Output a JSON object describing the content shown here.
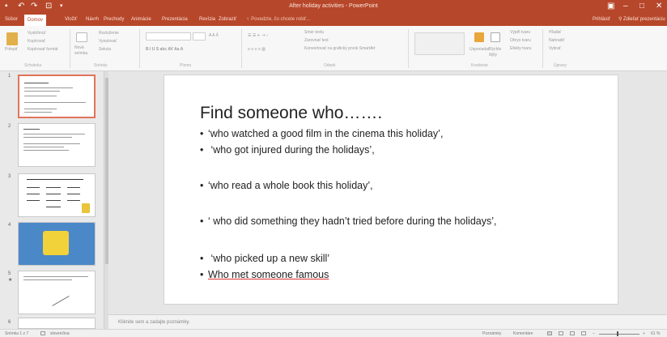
{
  "window": {
    "title": "After holiday activities - PowerPoint",
    "controls": {
      "restore": "▣",
      "minimize": "–",
      "maximize": "□",
      "close": "✕"
    },
    "qat": [
      "save-icon",
      "undo-icon",
      "redo-icon",
      "present-icon",
      "customize-icon"
    ]
  },
  "ribbon_tabs": {
    "items": [
      "Súbor",
      "Domov",
      "Vložiť",
      "Návrh",
      "Prechody",
      "Animácie",
      "Prezentácia",
      "Revízia",
      "Zobraziť"
    ],
    "active": "Domov",
    "tell_me": "♀ Povedzte, čo chcete robiť...",
    "sign_in": "Prihlásiť",
    "share": "⚲ Zdieľať prezentáciu"
  },
  "ribbon": {
    "clipboard": {
      "paste": "Prilepiť",
      "cut": "Vystrihnúť",
      "copy": "Kopírovať",
      "painter": "Kopírovať formát",
      "label": "Schránka"
    },
    "slides": {
      "new_slide": "Nová snímka",
      "layout": "Rozloženie",
      "reset": "Vynulovať",
      "section": "Sekcia",
      "label": "Snímky"
    },
    "font": {
      "label": "Písmo"
    },
    "paragraph": {
      "text_direction": "Smer textu",
      "align_text": "Zarovnať text",
      "smartart": "Konvertovať na grafický prvok SmartArt",
      "label": "Odsek"
    },
    "drawing": {
      "arrange": "Usporiadať",
      "quick_styles": "Rýchle štýly",
      "shape_fill": "Výplň tvaru",
      "shape_outline": "Obrys tvaru",
      "shape_effects": "Efekty tvaru",
      "label": "Kreslenie"
    },
    "editing": {
      "find": "Hľadať",
      "replace": "Nahradiť",
      "select": "Vybrať",
      "label": "Úpravy"
    }
  },
  "thumbnails": [
    "1",
    "2",
    "3",
    "4",
    "5",
    "6"
  ],
  "slide": {
    "title": "Find someone who…….",
    "bullets": [
      "‘who watched a good film in the cinema this holiday’,",
      " ‘who got injured during the holidays’,",
      "‘who read a whole book this holiday’,",
      "‘ who did something they hadn’t tried before during the holidays’,",
      " ‘who picked up a new skill’",
      "Who met someone famous"
    ]
  },
  "notes": {
    "placeholder": "Kliknite sem a zadajte poznámky."
  },
  "status": {
    "slide_info": "Snímka 1 z 7",
    "language": "slovenčina",
    "notes": "Poznámky",
    "comments": "Komentáre",
    "zoom": "61 %"
  },
  "colors": {
    "accent": "#b7472a",
    "selection": "#e0745a"
  }
}
